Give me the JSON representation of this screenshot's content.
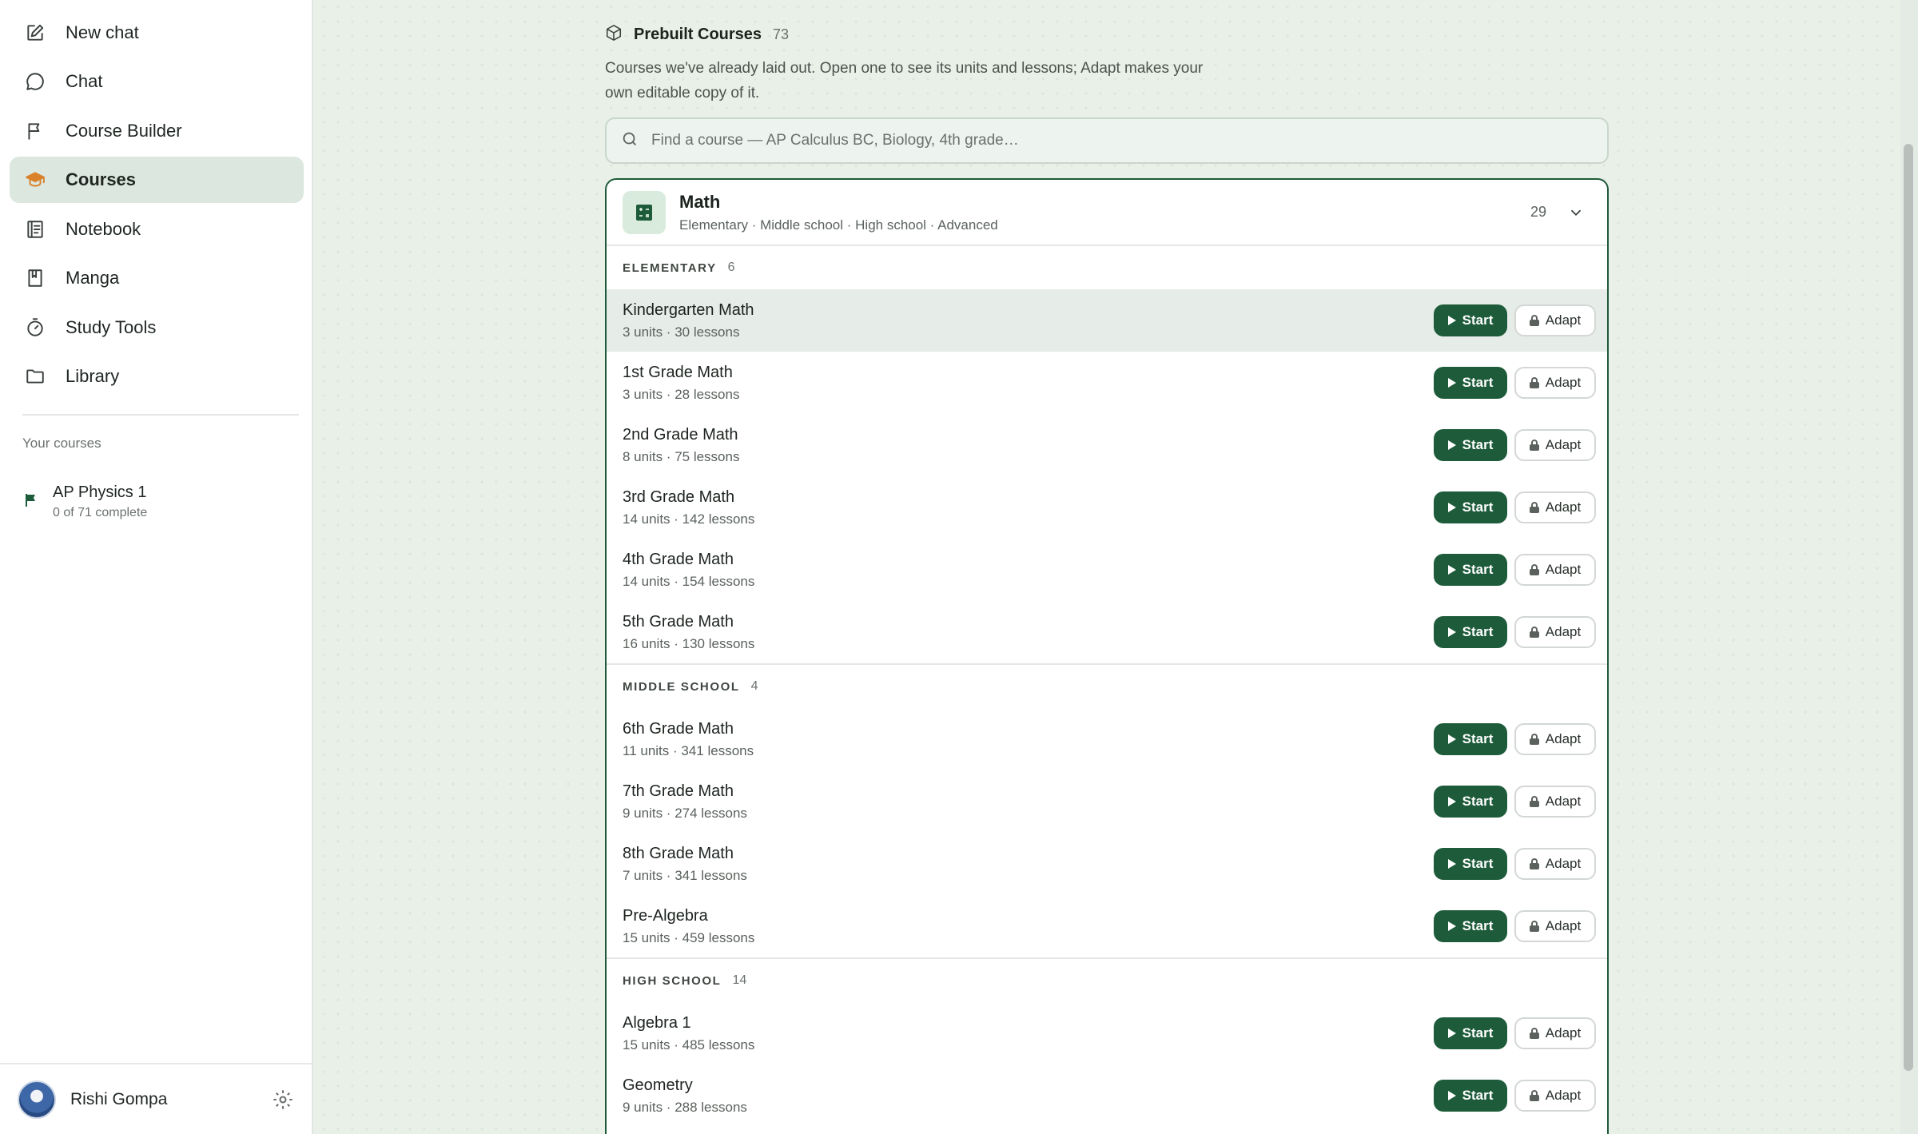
{
  "sidebar": {
    "nav": [
      {
        "label": "New chat",
        "icon": "edit-icon"
      },
      {
        "label": "Chat",
        "icon": "chat-bubble-icon"
      },
      {
        "label": "Course Builder",
        "icon": "flag-icon"
      },
      {
        "label": "Courses",
        "icon": "graduation-cap-icon",
        "active": true
      },
      {
        "label": "Notebook",
        "icon": "notebook-icon"
      },
      {
        "label": "Manga",
        "icon": "book-icon"
      },
      {
        "label": "Study Tools",
        "icon": "timer-icon"
      },
      {
        "label": "Library",
        "icon": "folder-icon"
      }
    ],
    "section_label": "Your courses",
    "your_courses": [
      {
        "title": "AP Physics 1",
        "progress": "0 of 71 complete"
      }
    ],
    "user": {
      "name": "Rishi Gompa"
    }
  },
  "main": {
    "title": "Prebuilt Courses",
    "count": "73",
    "description": "Courses we've already laid out. Open one to see its units and lessons; Adapt makes your own editable copy of it.",
    "search_placeholder": "Find a course — AP Calculus BC, Biology, 4th grade…",
    "subject": {
      "title": "Math",
      "levels": "Elementary · Middle school · High school · Advanced",
      "count": "29"
    },
    "start_label": "Start",
    "adapt_label": "Adapt",
    "groups": [
      {
        "label": "ELEMENTARY",
        "count": "6",
        "courses": [
          {
            "title": "Kindergarten Math",
            "meta": "3 units · 30 lessons"
          },
          {
            "title": "1st Grade Math",
            "meta": "3 units · 28 lessons"
          },
          {
            "title": "2nd Grade Math",
            "meta": "8 units · 75 lessons"
          },
          {
            "title": "3rd Grade Math",
            "meta": "14 units · 142 lessons"
          },
          {
            "title": "4th Grade Math",
            "meta": "14 units · 154 lessons"
          },
          {
            "title": "5th Grade Math",
            "meta": "16 units · 130 lessons"
          }
        ]
      },
      {
        "label": "MIDDLE SCHOOL",
        "count": "4",
        "courses": [
          {
            "title": "6th Grade Math",
            "meta": "11 units · 341 lessons"
          },
          {
            "title": "7th Grade Math",
            "meta": "9 units · 274 lessons"
          },
          {
            "title": "8th Grade Math",
            "meta": "7 units · 341 lessons"
          },
          {
            "title": "Pre-Algebra",
            "meta": "15 units · 459 lessons"
          }
        ]
      },
      {
        "label": "HIGH SCHOOL",
        "count": "14",
        "courses": [
          {
            "title": "Algebra 1",
            "meta": "15 units · 485 lessons"
          },
          {
            "title": "Geometry",
            "meta": "9 units · 288 lessons"
          }
        ]
      }
    ]
  },
  "colors": {
    "accent": "#1d5b3a",
    "active_icon": "#d9822b",
    "background": "#e9f0e8"
  }
}
